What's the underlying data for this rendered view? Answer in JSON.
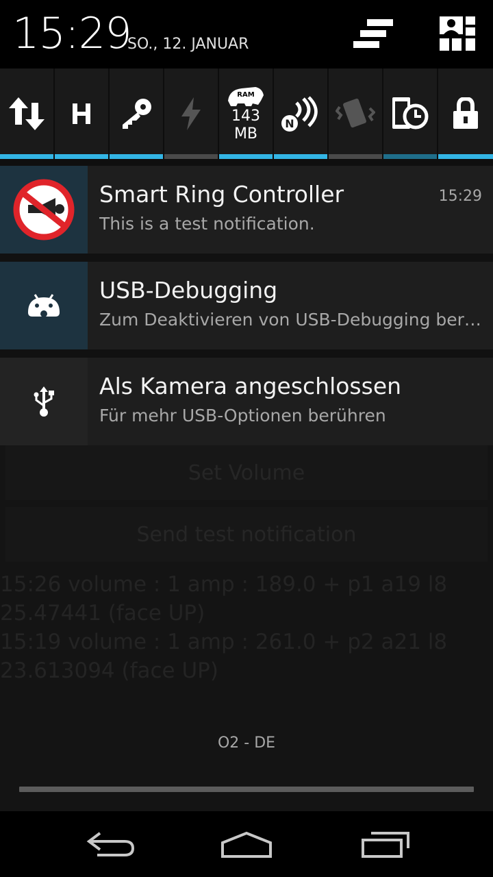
{
  "status": {
    "time": "15:29",
    "date": "SO., 12. JANUAR"
  },
  "quick_settings": [
    {
      "name": "data",
      "icon": "data-transfer-icon",
      "state": "on"
    },
    {
      "name": "hspa",
      "icon": "h-network-icon",
      "state": "on"
    },
    {
      "name": "vpn",
      "icon": "key-icon",
      "state": "on"
    },
    {
      "name": "flash",
      "icon": "flashlight-icon",
      "state": "off"
    },
    {
      "name": "ram",
      "icon": "ram-rhino-icon",
      "label_line1": "143",
      "label_line2": "MB",
      "badge": "RAM",
      "state": "on"
    },
    {
      "name": "nfc",
      "icon": "nfc-icon",
      "state": "on"
    },
    {
      "name": "vibrate",
      "icon": "vibrate-icon",
      "state": "off"
    },
    {
      "name": "screen-timeout",
      "icon": "screen-timeout-icon",
      "state": "dim"
    },
    {
      "name": "lock",
      "icon": "lock-icon",
      "state": "on"
    }
  ],
  "notifications": [
    {
      "title": "Smart Ring Controller",
      "text": "This is a test notification.",
      "time": "15:29",
      "icon": "no-horn-icon"
    },
    {
      "title": "USB-Debugging",
      "text": "Zum Deaktivieren von USB-Debugging berü..",
      "icon": "android-debug-icon"
    },
    {
      "title": "Als Kamera angeschlossen",
      "text": "Für mehr USB-Optionen berühren",
      "icon": "usb-icon"
    }
  ],
  "background_app": {
    "button1": "Set Volume",
    "button2": "Send test notification",
    "log": "15:26 volume : 1 amp : 189.0 + p1 a19 l8\n25.47441 (face UP)\n15:19 volume : 1 amp : 261.0 + p2 a21 l8\n23.613094 (face UP)"
  },
  "carrier": "O2 - DE",
  "colors": {
    "accent": "#33b5e5",
    "off_bar": "#4a4a4a",
    "notification_bg": "#1e1e1e",
    "icon_box_teal": "#1d3340"
  }
}
